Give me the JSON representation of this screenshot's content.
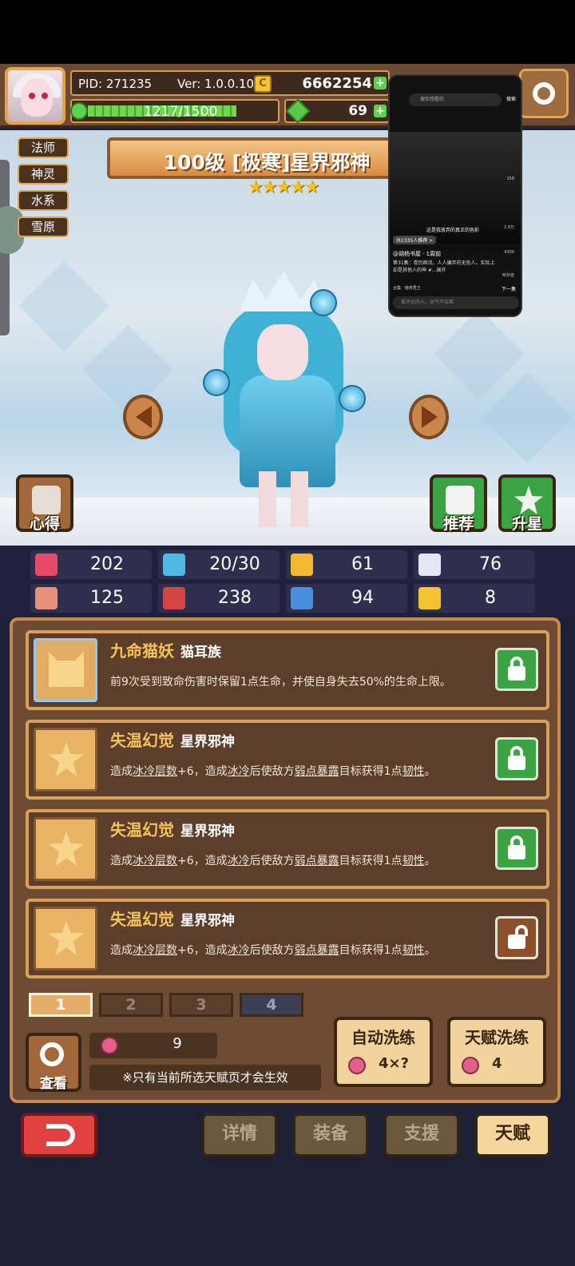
{
  "header": {
    "pid": "PID: 271235",
    "version": "Ver: 1.0.0.10",
    "coin_symbol": "C",
    "gold": "6662254",
    "energy": "1217/1500",
    "energy_fraction": 0.81,
    "gems": "69",
    "plus": "+"
  },
  "hero": {
    "tags": [
      "法师",
      "神灵",
      "水系",
      "雪原"
    ],
    "title": "100级 [极寒]星界邪神",
    "stars": "★★★★★",
    "star_count": 5
  },
  "scene_buttons": {
    "insight": "心得",
    "recommend": "推荐",
    "upgrade_star": "升星"
  },
  "stats": [
    {
      "icon": "heart-icon",
      "value": "202",
      "color": "#e64a67"
    },
    {
      "icon": "water-drop-icon",
      "value": "20/30",
      "color": "#4fb8e6"
    },
    {
      "icon": "shield-icon",
      "value": "61",
      "color": "#f2b931"
    },
    {
      "icon": "wing-icon",
      "value": "76",
      "color": "#e6e6f2"
    },
    {
      "icon": "fist-icon",
      "value": "125",
      "color": "#e8917a"
    },
    {
      "icon": "spellbook-icon",
      "value": "238",
      "color": "#d24545"
    },
    {
      "icon": "scroll-icon",
      "value": "94",
      "color": "#4a8fdb"
    },
    {
      "icon": "horseshoe-icon",
      "value": "8",
      "color": "#f2c331"
    }
  ],
  "talents": [
    {
      "name": "九命猫妖",
      "race": "猫耳族",
      "desc_parts": [
        "前9次受到致命伤害时保留1点生命，并使自身失去50%的生命上限。",
        "",
        "",
        "",
        "",
        "",
        "",
        ""
      ],
      "locked": true
    },
    {
      "name": "失温幻觉",
      "race": "星界邪神",
      "desc_parts": [
        "造成",
        "冰冷层数",
        "+6，造成",
        "冰冷",
        "后使敌方",
        "弱点暴露",
        "目标获得1点",
        "韧性",
        "。"
      ],
      "locked": true
    },
    {
      "name": "失温幻觉",
      "race": "星界邪神",
      "desc_parts": [
        "造成",
        "冰冷层数",
        "+6，造成",
        "冰冷",
        "后使敌方",
        "弱点暴露",
        "目标获得1点",
        "韧性",
        "。"
      ],
      "locked": true
    },
    {
      "name": "失温幻觉",
      "race": "星界邪神",
      "desc_parts": [
        "造成",
        "冰冷层数",
        "+6，造成",
        "冰冷",
        "后使敌方",
        "弱点暴露",
        "目标获得1点",
        "韧性",
        "。"
      ],
      "locked": false
    }
  ],
  "pages": [
    "1",
    "2",
    "3",
    "4"
  ],
  "bottom_panel": {
    "view": "查看",
    "fruit_count": "9",
    "note": "※只有当前所选天赋页才会生效",
    "auto_wash": "自动洗练",
    "auto_wash_cost": "4×?",
    "talent_wash": "天赋洗练",
    "talent_wash_cost": "4"
  },
  "nav": {
    "details": "详情",
    "equipment": "装备",
    "support": "支援",
    "talent": "天赋"
  },
  "overlay": {
    "search_placeholder": "搜你想看的",
    "search_button": "搜索",
    "caption": "这是我放弃的真正的色彩",
    "likes": "共1335人推荐 >",
    "user": "@胡杨书屋 · 1周前",
    "text": "第31集：卷历群流，人人嫌弃的无色人。实际上却是其他人的神 #...展开",
    "collection": "合集 · 暗夜君王",
    "next": "下一集",
    "comment_placeholder": "爱评论的人，运气不会差",
    "counts": [
      "158",
      "2.6万",
      "4300",
      "听抖音"
    ]
  }
}
